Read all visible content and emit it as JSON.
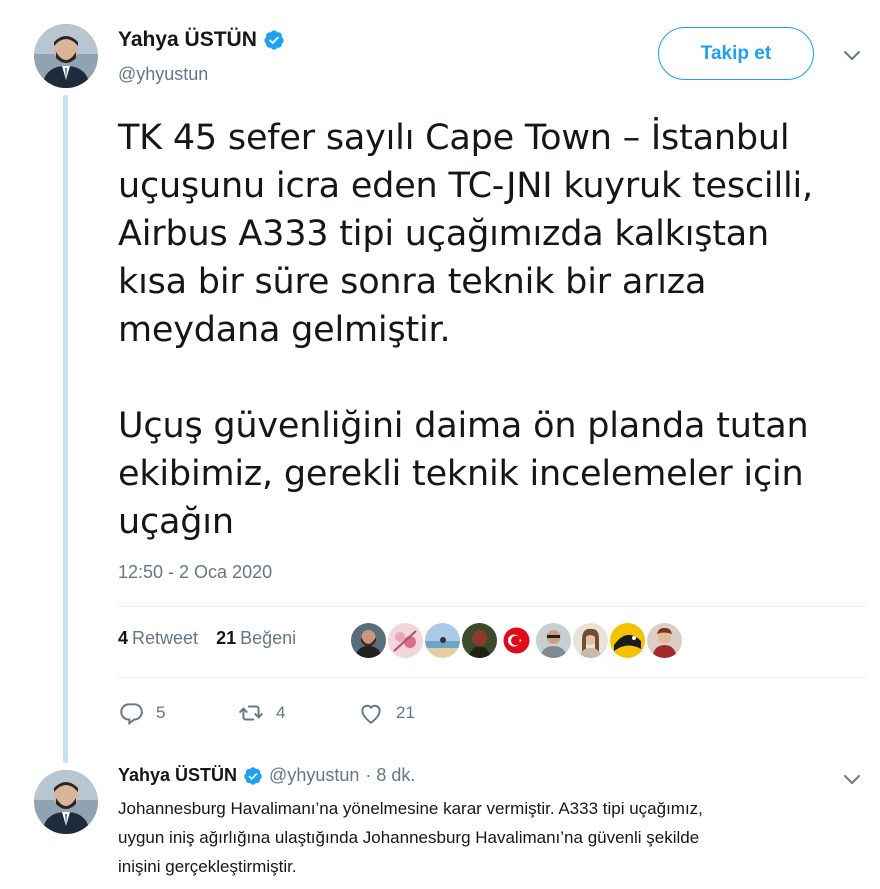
{
  "tweet": {
    "author": {
      "name": "Yahya ÜSTÜN",
      "handle": "@yhyustun",
      "verified": true
    },
    "follow_label": "Takip et",
    "text_lines": [
      "TK 45 sefer sayılı Cape Town – İstanbul",
      "uçuşunu icra eden TC-JNI kuyruk tescilli,",
      "Airbus A333 tipi uçağımızda kalkıştan",
      "kısa bir süre sonra teknik bir arıza",
      "meydana gelmiştir.",
      "",
      "Uçuş güvenliğini daima ön planda tutan",
      "ekibimiz, gerekli teknik incelemeler için",
      "uçağın"
    ],
    "timestamp": "12:50 - 2 Oca 2020",
    "stats": {
      "retweet_count": "4",
      "retweet_label": "Retweet",
      "like_count": "21",
      "like_label": "Beğeni"
    },
    "likers": [
      {
        "icon": "avatar-man-beard",
        "color": "#5a6d7c"
      },
      {
        "icon": "avatar-pink-flowers",
        "color": "#e9a6b4"
      },
      {
        "icon": "avatar-beach",
        "color": "#6fa3c9"
      },
      {
        "icon": "avatar-red-green",
        "color": "#3c4b2a"
      },
      {
        "icon": "avatar-turkish-flag-logo",
        "color": "#e30a17"
      },
      {
        "icon": "avatar-man-glasses",
        "color": "#7d8a8f"
      },
      {
        "icon": "avatar-woman",
        "color": "#c9b9a8"
      },
      {
        "icon": "avatar-yellow-black",
        "color": "#f3c300"
      },
      {
        "icon": "avatar-woman-red",
        "color": "#a32a2a"
      }
    ],
    "actions": {
      "reply_count": "5",
      "retweet_count": "4",
      "like_count": "21"
    }
  },
  "reply": {
    "author": {
      "name": "Yahya ÜSTÜN",
      "handle": "@yhyustun",
      "verified": true
    },
    "time": "· 8 dk.",
    "text_lines": [
      "Johannesburg Havalimanı’na yönelmesine karar vermiştir. A333 tipi uçağımız,",
      "uygun iniş ağırlığına ulaştığında Johannesburg Havalimanı’na güvenli şekilde",
      "inişini gerçekleştirmiştir."
    ]
  },
  "colors": {
    "accent": "#1da1f2",
    "secondary_text": "#657786",
    "thread_line": "#c5e2f7"
  }
}
